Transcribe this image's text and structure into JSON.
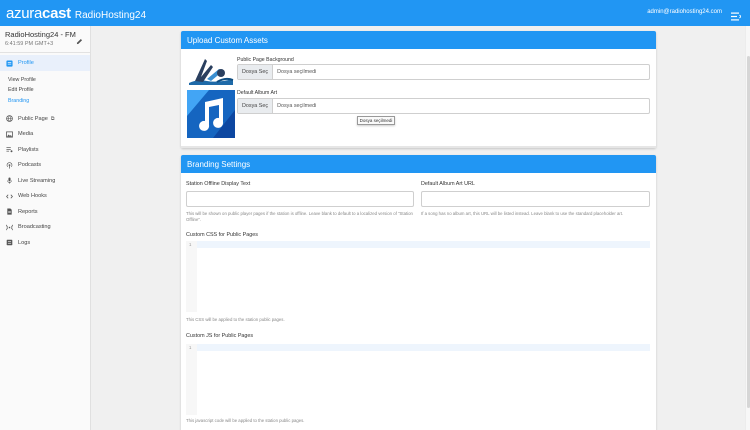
{
  "topbar": {
    "logo_part1": "azura",
    "logo_part2": "cast",
    "station": "RadioHosting24",
    "user_email": "admin@radiohosting24.com"
  },
  "sidebar": {
    "station_name": "RadioHosting24 - FM",
    "station_time": "6:41:59 PM GMT+3",
    "profile_label": "Profile",
    "sub_items": [
      "View Profile",
      "Edit Profile",
      "Branding"
    ],
    "items": [
      {
        "label": "Public Page",
        "icon": "globe-icon"
      },
      {
        "label": "Media",
        "icon": "image-icon"
      },
      {
        "label": "Playlists",
        "icon": "playlist-icon"
      },
      {
        "label": "Podcasts",
        "icon": "podcast-icon"
      },
      {
        "label": "Live Streaming",
        "icon": "mic-icon"
      },
      {
        "label": "Web Hooks",
        "icon": "code-icon"
      },
      {
        "label": "Reports",
        "icon": "document-icon"
      },
      {
        "label": "Broadcasting",
        "icon": "broadcast-icon"
      },
      {
        "label": "Logs",
        "icon": "logs-icon"
      }
    ]
  },
  "upload_card": {
    "title": "Upload Custom Assets",
    "bg_label": "Public Page Background",
    "art_label": "Default Album Art",
    "button_label": "Dosya Seç",
    "no_file": "Dosya seçilmedi",
    "tooltip": "Dosya seçilmedi"
  },
  "branding_card": {
    "title": "Branding Settings",
    "offline_label": "Station Offline Display Text",
    "offline_help": "This will be shown on public player pages if the station is offline. Leave blank to default to a localized version of \"Station Offline\".",
    "album_url_label": "Default Album Art URL",
    "album_url_help": "If a song has no album art, this URL will be listed instead. Leave blank to use the standard placeholder art.",
    "css_label": "Custom CSS for Public Pages",
    "css_help": "This CSS will be applied to the station public pages.",
    "js_label": "Custom JS for Public Pages",
    "js_help": "This javascript code will be applied to the station public pages.",
    "line_number": "1"
  },
  "colors": {
    "accent": "#2196f3",
    "active_bg": "#e9f0fb"
  }
}
